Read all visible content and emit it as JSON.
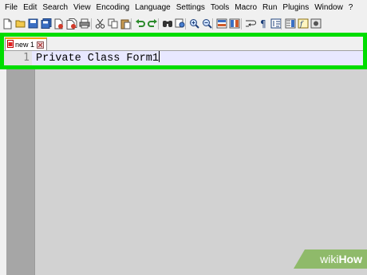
{
  "menu": {
    "items": [
      "File",
      "Edit",
      "Search",
      "View",
      "Encoding",
      "Language",
      "Settings",
      "Tools",
      "Macro",
      "Run",
      "Plugins",
      "Window",
      "?"
    ]
  },
  "toolbar": {
    "buttons": [
      "new-file-icon",
      "open-file-icon",
      "save-icon",
      "save-all-icon",
      "close-icon",
      "close-all-icon",
      "print-icon",
      "cut-icon",
      "copy-icon",
      "paste-icon",
      "undo-icon",
      "redo-icon",
      "find-icon",
      "replace-icon",
      "zoom-in-icon",
      "zoom-out-icon",
      "sync-vertical-icon",
      "sync-horizontal-icon",
      "word-wrap-icon",
      "show-all-chars-icon",
      "indent-guide-icon",
      "doc-map-icon",
      "function-list-icon",
      "macro-record-icon"
    ]
  },
  "tabs": [
    {
      "label": "new 1",
      "active": true
    }
  ],
  "editor": {
    "line_number": "1",
    "line_text": "Private Class Form1"
  },
  "watermark": {
    "part1": "wiki",
    "part2": "How"
  },
  "colors": {
    "highlight": "#00dd00",
    "editor_background": "#d2d2d2",
    "current_line": "#e8e8ff",
    "tab_accent": "#f3a400"
  }
}
